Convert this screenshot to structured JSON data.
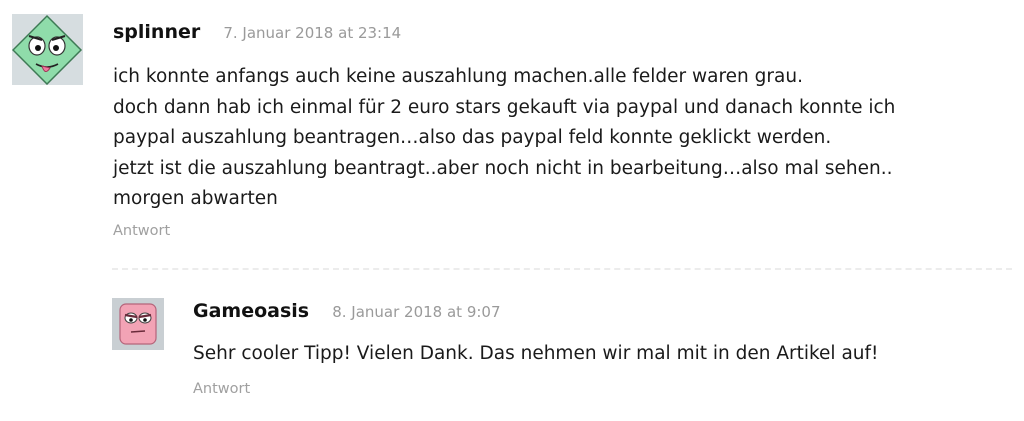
{
  "comments": [
    {
      "author": "splinner",
      "date": "7. Januar 2018 at 23:14",
      "lines": [
        "ich konnte anfangs auch keine auszahlung machen.alle felder waren grau.",
        "doch dann hab ich einmal für 2 euro stars gekauft via paypal und danach konnte ich",
        "paypal auszahlung beantragen…also das paypal feld konnte geklickt werden.",
        "jetzt ist die auszahlung beantragt..aber noch nicht in bearbeitung…also mal sehen..",
        "morgen abwarten"
      ],
      "reply_label": "Antwort",
      "avatar_icon": "green-monster-avatar"
    },
    {
      "author": "Gameoasis",
      "date": "8. Januar 2018 at 9:07",
      "lines": [
        "Sehr cooler Tipp! Vielen Dank. Das nehmen wir mal mit in den Artikel auf!"
      ],
      "reply_label": "Antwort",
      "avatar_icon": "pink-monster-avatar"
    }
  ],
  "colors": {
    "meta_gray": "#9a9a9a",
    "text": "#1a1a1a",
    "divider": "#ececec"
  }
}
